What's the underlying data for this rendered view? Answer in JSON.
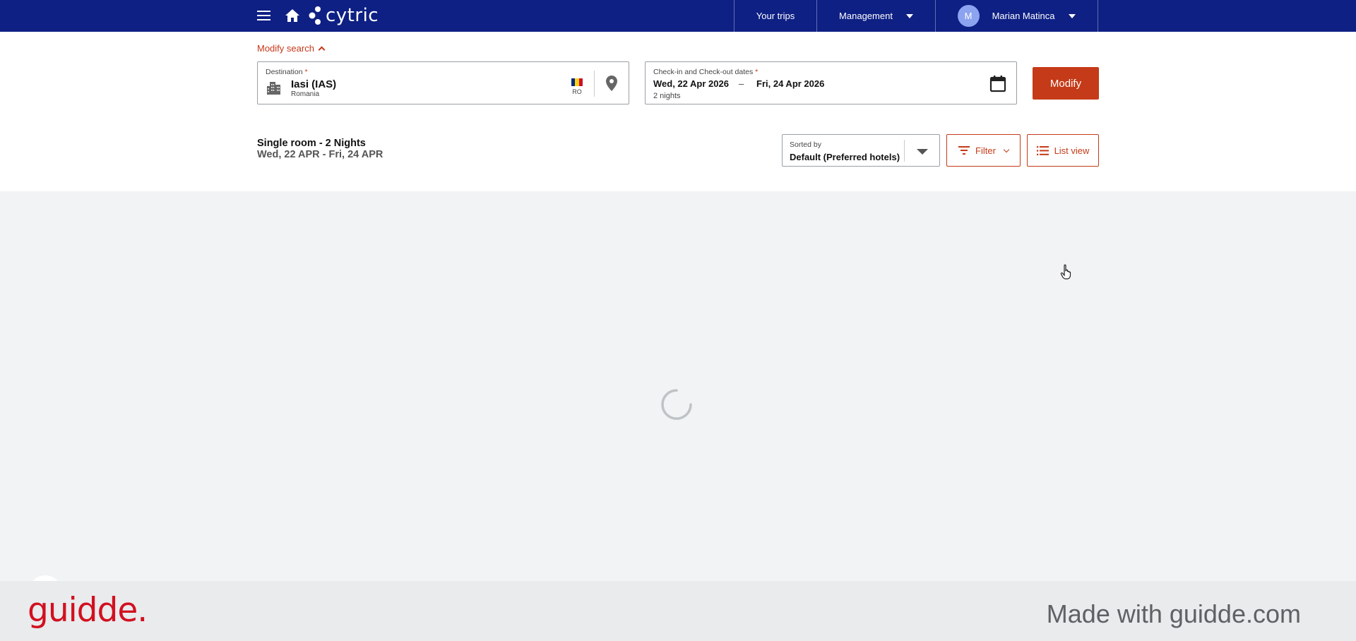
{
  "header": {
    "logo_text": "cytric",
    "nav": {
      "your_trips": "Your trips",
      "management": "Management",
      "user_initial": "M",
      "user_name": "Marian Matinca"
    }
  },
  "search": {
    "modify_search_label": "Modify search",
    "destination": {
      "label": "Destination",
      "required_mark": "*",
      "value": "Iasi (IAS)",
      "country": "Romania",
      "country_code": "RO"
    },
    "dates": {
      "label": "Check-in and Check-out dates",
      "required_mark": "*",
      "checkin": "Wed, 22 Apr 2026",
      "separator": "–",
      "checkout": "Fri, 24 Apr 2026",
      "nights": "2 nights"
    },
    "modify_button": "Modify"
  },
  "results_bar": {
    "summary_title": "Single room - 2 Nights",
    "summary_dates": "Wed, 22 APR - Fri, 24 APR",
    "sort": {
      "label": "Sorted by",
      "value": "Default (Preferred hotels)"
    },
    "filter_button": "Filter",
    "list_view_button": "List view"
  },
  "footer": {
    "brand": "guidde.",
    "made_with": "Made with guidde.com"
  },
  "colors": {
    "topbar": "#0e2084",
    "accent": "#c53a18",
    "background": "#f1f3f4",
    "guidde_brand": "#d2101f"
  },
  "icons": [
    "menu-icon",
    "home-icon",
    "cytric-logo-icon",
    "building-icon",
    "romania-flag-icon",
    "map-pin-icon",
    "calendar-icon",
    "filter-icon",
    "list-icon",
    "loading-spinner-icon",
    "hand-cursor-icon"
  ]
}
